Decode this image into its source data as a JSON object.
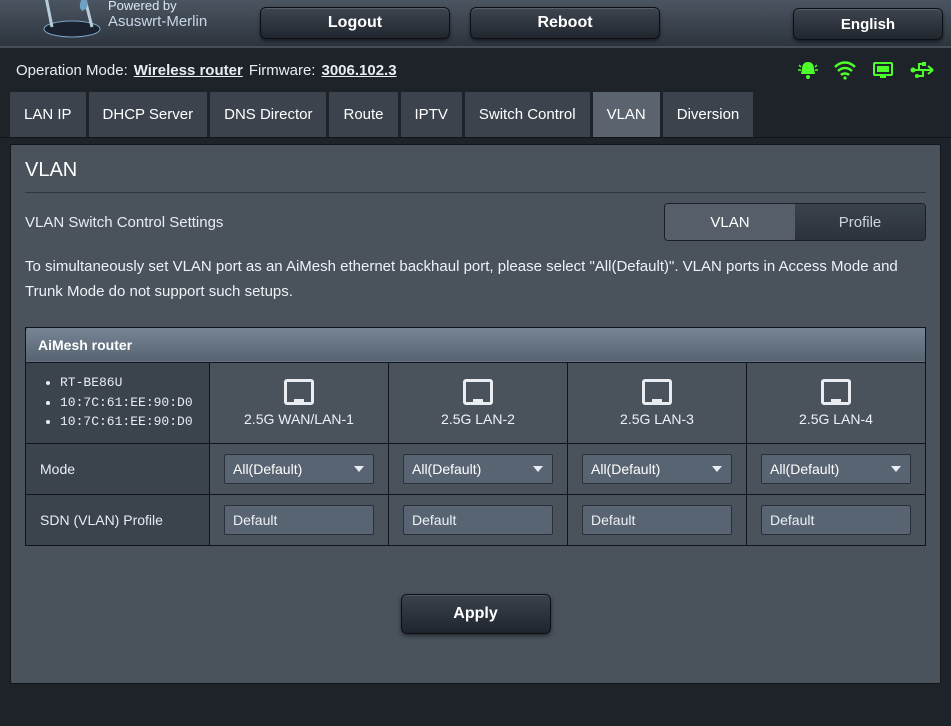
{
  "header": {
    "powered_line1": "Powered by",
    "powered_line2": "Asuswrt-Merlin",
    "logout": "Logout",
    "reboot": "Reboot",
    "language": "English"
  },
  "status": {
    "op_mode_label": "Operation Mode:",
    "op_mode_value": "Wireless router",
    "firmware_label": "Firmware:",
    "firmware_value": "3006.102.3"
  },
  "tabs": [
    {
      "id": "lanip",
      "label": "LAN IP"
    },
    {
      "id": "dhcp",
      "label": "DHCP Server"
    },
    {
      "id": "dns",
      "label": "DNS Director"
    },
    {
      "id": "route",
      "label": "Route"
    },
    {
      "id": "iptv",
      "label": "IPTV"
    },
    {
      "id": "switch",
      "label": "Switch Control"
    },
    {
      "id": "vlan",
      "label": "VLAN",
      "active": true
    },
    {
      "id": "diversion",
      "label": "Diversion"
    }
  ],
  "page": {
    "title": "VLAN",
    "subheader": "VLAN Switch Control Settings",
    "toggle": {
      "vlan": "VLAN",
      "profile": "Profile"
    },
    "info": "To simultaneously set VLAN port as an AiMesh ethernet backhaul port, please select \"All(Default)\". VLAN ports in Access Mode and Trunk Mode do not support such setups."
  },
  "table": {
    "section_head": "AiMesh router",
    "device": {
      "model": "RT-BE86U",
      "mac1": "10:7C:61:EE:90:D0",
      "mac2": "10:7C:61:EE:90:D0"
    },
    "ports": [
      {
        "label": "2.5G WAN/LAN-1"
      },
      {
        "label": "2.5G LAN-2"
      },
      {
        "label": "2.5G LAN-3"
      },
      {
        "label": "2.5G LAN-4"
      }
    ],
    "rows": {
      "mode_label": "Mode",
      "mode_value": "All(Default)",
      "sdn_label": "SDN (VLAN) Profile",
      "sdn_value": "Default"
    },
    "apply": "Apply"
  },
  "colors": {
    "accent_green": "#39ff14"
  }
}
